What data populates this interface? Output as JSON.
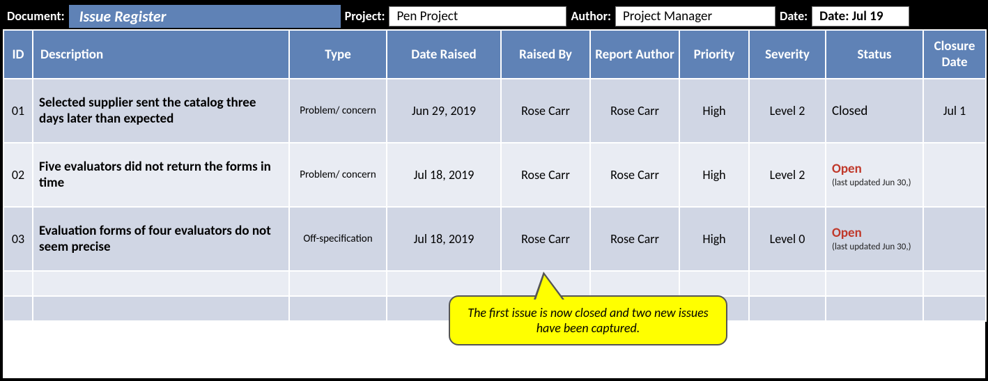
{
  "topbar": {
    "document_label": "Document:",
    "document_title": "Issue Register",
    "project_label": "Project:",
    "project_value": "Pen Project",
    "author_label": "Author:",
    "author_value": "Project Manager",
    "date_label": "Date:",
    "date_value": "Date: Jul 19"
  },
  "headers": {
    "id": "ID",
    "description": "Description",
    "type": "Type",
    "date_raised": "Date Raised",
    "raised_by": "Raised By",
    "report_author": "Report Author",
    "priority": "Priority",
    "severity": "Severity",
    "status": "Status",
    "closure_date": "Closure Date"
  },
  "rows": [
    {
      "id": "01",
      "description": "Selected supplier sent the catalog three days later than expected",
      "type": "Problem/ concern",
      "date_raised": "Jun 29, 2019",
      "raised_by": "Rose Carr",
      "report_author": "Rose Carr",
      "priority": "High",
      "severity": "Level 2",
      "status_main": "Closed",
      "status_open": false,
      "status_sub": "",
      "closure_date": "Jul 1"
    },
    {
      "id": "02",
      "description": "Five evaluators did not return the forms in time",
      "type": "Problem/ concern",
      "date_raised": "Jul 18, 2019",
      "raised_by": "Rose Carr",
      "report_author": "Rose Carr",
      "priority": "High",
      "severity": "Level 2",
      "status_main": "Open",
      "status_open": true,
      "status_sub": "(last updated Jun 30,)",
      "closure_date": ""
    },
    {
      "id": "03",
      "description": "Evaluation forms of four evaluators do not seem precise",
      "type": "Off-specification",
      "date_raised": "Jul 18, 2019",
      "raised_by": "Rose Carr",
      "report_author": "Rose Carr",
      "priority": "High",
      "severity": "Level 0",
      "status_main": "Open",
      "status_open": true,
      "status_sub": "(last updated Jun 30,)",
      "closure_date": ""
    }
  ],
  "callout": "The first issue is now closed and two new issues have been captured."
}
